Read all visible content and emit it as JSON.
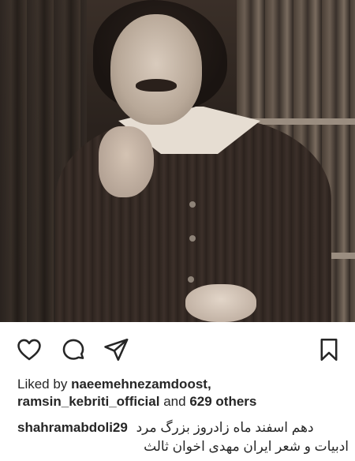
{
  "post": {
    "liked_prefix": "Liked by",
    "liked_user": "naeemehnezamdoost,",
    "liked_user2": "ramsin_kebriti_official",
    "liked_and": "and",
    "liked_others": "629 others",
    "caption_user": "shahramabdoli29",
    "caption_line1": "دهم اسفند ماه زادروز بزرگ مرد",
    "caption_line2": "ادبیات و شعر ایران مهدی اخوان ثالث"
  },
  "icons": {
    "like": "heart-icon",
    "comment": "comment-icon",
    "share": "send-icon",
    "save": "bookmark-icon"
  },
  "colors": {
    "text": "#262626",
    "background": "#ffffff"
  }
}
